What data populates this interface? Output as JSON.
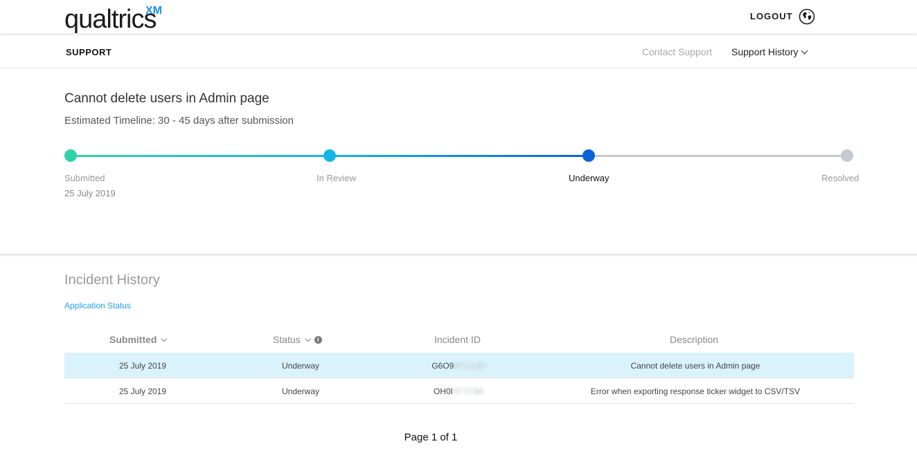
{
  "header": {
    "logo_text": "qualtrics",
    "logo_suffix": "XM",
    "logout_label": "LOGOUT",
    "globe_icon": "globe-icon"
  },
  "subnav": {
    "section": "SUPPORT",
    "contact_label": "Contact Support",
    "history_label": "Support History"
  },
  "incident": {
    "title": "Cannot delete users in Admin page",
    "timeline": "Estimated Timeline: 30 - 45 days after submission",
    "stages": [
      {
        "label": "Submitted",
        "state": "complete",
        "color": "#2ed4a8"
      },
      {
        "label": "In Review",
        "state": "complete",
        "color": "#12b5e6"
      },
      {
        "label": "Underway",
        "state": "current",
        "color": "#0b63d9"
      },
      {
        "label": "Resolved",
        "state": "pending",
        "color": "#c6c8d2"
      }
    ],
    "submitted_date": "25 July 2019"
  },
  "history": {
    "title": "Incident History",
    "app_status_link": "Application Status",
    "columns": [
      "Submitted",
      "Status",
      "Incident ID",
      "Description"
    ],
    "rows": [
      {
        "submitted": "25 July 2019",
        "status": "Underway",
        "id_prefix": "G6O9",
        "id_hidden": "8F1Q3D",
        "description": "Cannot delete users in Admin page",
        "selected": true
      },
      {
        "submitted": "25 July 2019",
        "status": "Underway",
        "id_prefix": "OH0I",
        "id_hidden": "4T7C9B",
        "description": "Error when exporting response ticker widget to CSV/TSV",
        "selected": false
      }
    ],
    "pager": "Page 1 of 1"
  }
}
